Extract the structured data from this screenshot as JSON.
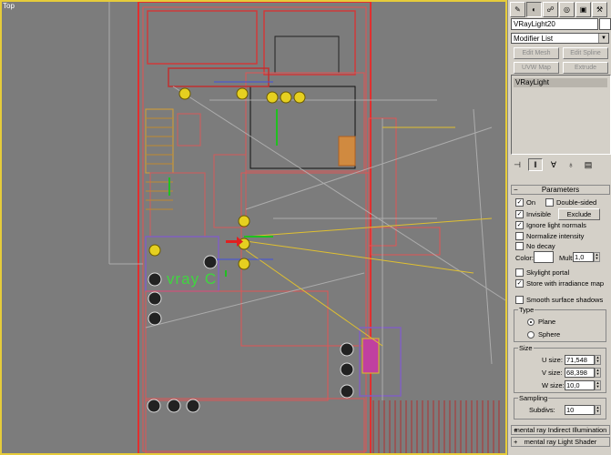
{
  "viewport": {
    "label": "Top",
    "overlay_text": "vray C"
  },
  "panel": {
    "tabs": [
      {
        "icon": "create-icon"
      },
      {
        "icon": "modify-icon"
      },
      {
        "icon": "hierarchy-icon"
      },
      {
        "icon": "motion-icon"
      },
      {
        "icon": "display-icon"
      },
      {
        "icon": "utilities-icon"
      }
    ],
    "object_name": "VRayLight20",
    "object_color": "#ffffff",
    "modifier_list": "Modifier List",
    "mod_buttons": [
      "Edit Mesh",
      "Edit Spline",
      "UVW Map",
      "Extrude"
    ],
    "stack_item": "VRayLight",
    "parameters": {
      "title": "Parameters",
      "on_label": "On",
      "double_sided_label": "Double-sided",
      "invisible_label": "Invisible",
      "exclude_label": "Exclude",
      "ignore_normals_label": "Ignore light normals",
      "normalize_label": "Normalize intensity",
      "no_decay_label": "No decay",
      "color_label": "Color:",
      "mult_label": "Mult:",
      "mult_value": "1,0",
      "skylight_label": "Skylight portal",
      "store_irradiance_label": "Store with irradiance map",
      "smooth_shadows_label": "Smooth surface shadows",
      "type_group": "Type",
      "type_plane": "Plane",
      "type_sphere": "Sphere",
      "size_group": "Size",
      "u_size_label": "U size:",
      "u_size_value": "71,548",
      "v_size_label": "V size:",
      "v_size_value": "68,398",
      "w_size_label": "W size:",
      "w_size_value": "10,0",
      "sampling_group": "Sampling",
      "subdivs_label": "Subdivs:",
      "subdivs_value": "10"
    },
    "collapsed_rollouts": [
      "mental ray Indirect Illumination",
      "mental ray Light Shader"
    ]
  }
}
